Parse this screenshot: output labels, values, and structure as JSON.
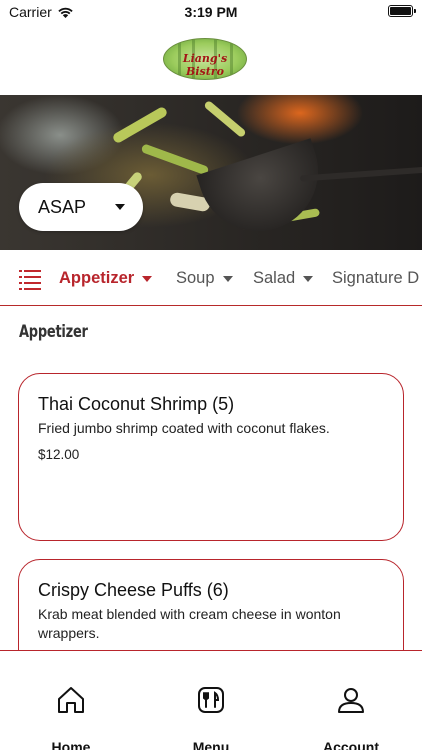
{
  "status": {
    "carrier": "Carrier",
    "time": "3:19 PM"
  },
  "logo": {
    "text": "Liang's Bistro"
  },
  "order_time": {
    "label": "ASAP"
  },
  "categories": [
    {
      "label": "Appetizer",
      "active": true
    },
    {
      "label": "Soup",
      "active": false
    },
    {
      "label": "Salad",
      "active": false
    },
    {
      "label": "Signature D",
      "active": false
    }
  ],
  "section": {
    "title": "Appetizer"
  },
  "items": [
    {
      "name": "Thai Coconut Shrimp (5)",
      "description": "Fried jumbo shrimp coated with coconut flakes.",
      "price": "$12.00"
    },
    {
      "name": "Crispy Cheese Puffs (6)",
      "description": "Krab meat blended with cream cheese in wonton wrappers.",
      "price": ""
    }
  ],
  "nav": [
    {
      "label": "Home",
      "icon": "home-icon"
    },
    {
      "label": "Menu",
      "icon": "menu-utensils-icon"
    },
    {
      "label": "Account",
      "icon": "account-icon"
    }
  ],
  "colors": {
    "accent": "#b8252c",
    "background": "#ffffff"
  }
}
